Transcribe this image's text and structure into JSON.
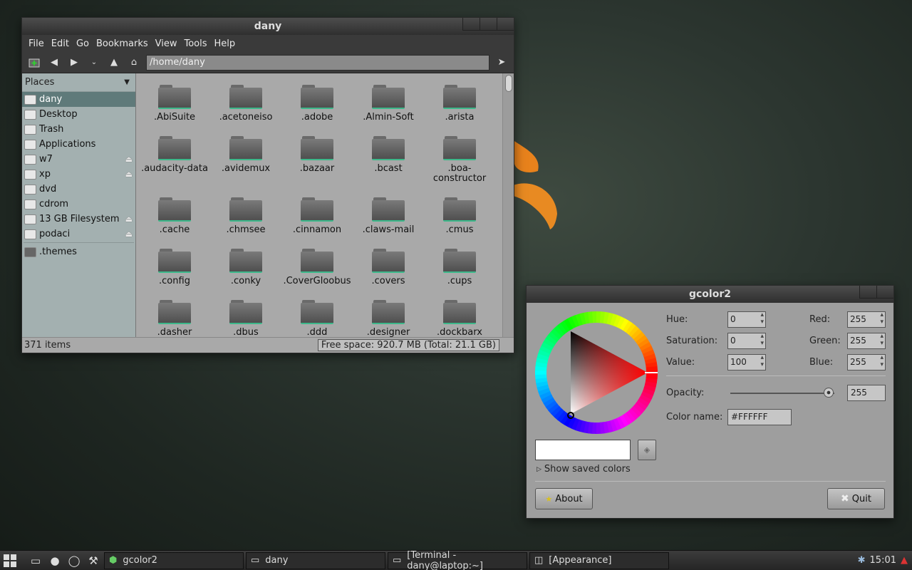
{
  "file_manager": {
    "title": "dany",
    "menu": [
      "File",
      "Edit",
      "Go",
      "Bookmarks",
      "View",
      "Tools",
      "Help"
    ],
    "path": "/home/dany",
    "sidebar_header": "Places",
    "sidebar_items": [
      "dany",
      "Desktop",
      "Trash",
      "Applications",
      "w7",
      "xp",
      "dvd",
      "cdrom",
      "13 GB Filesystem",
      "podaci"
    ],
    "bookmarks": [
      ".themes"
    ],
    "folders": [
      ".AbiSuite",
      ".acetoneiso",
      ".adobe",
      ".Almin-Soft",
      ".arista",
      ".audacity-data",
      ".avidemux",
      ".bazaar",
      ".bcast",
      ".boa-\nconstructor",
      ".cache",
      ".chmsee",
      ".cinnamon",
      ".claws-mail",
      ".cmus",
      ".config",
      ".conky",
      ".CoverGloobus",
      ".covers",
      ".cups",
      ".dasher",
      ".dbus",
      ".ddd",
      ".designer",
      ".dockbarx"
    ],
    "item_count": "371 items",
    "free_space": "Free space: 920.7 MB (Total: 21.1 GB)"
  },
  "gcolor2": {
    "title": "gcolor2",
    "hue_label": "Hue:",
    "hue": "0",
    "saturation_label": "Saturation:",
    "saturation": "0",
    "value_label": "Value:",
    "value": "100",
    "red_label": "Red:",
    "red": "255",
    "green_label": "Green:",
    "green": "255",
    "blue_label": "Blue:",
    "blue": "255",
    "opacity_label": "Opacity:",
    "opacity": "255",
    "color_name_label": "Color name:",
    "color_name": "#FFFFFF",
    "show_saved": "Show saved colors",
    "about": "About",
    "quit": "Quit",
    "current_color": "#FFFFFF"
  },
  "taskbar": {
    "tasks": [
      "gcolor2",
      "dany",
      "[Terminal - dany@laptop:~]",
      "[Appearance]"
    ],
    "clock": "15:01"
  }
}
